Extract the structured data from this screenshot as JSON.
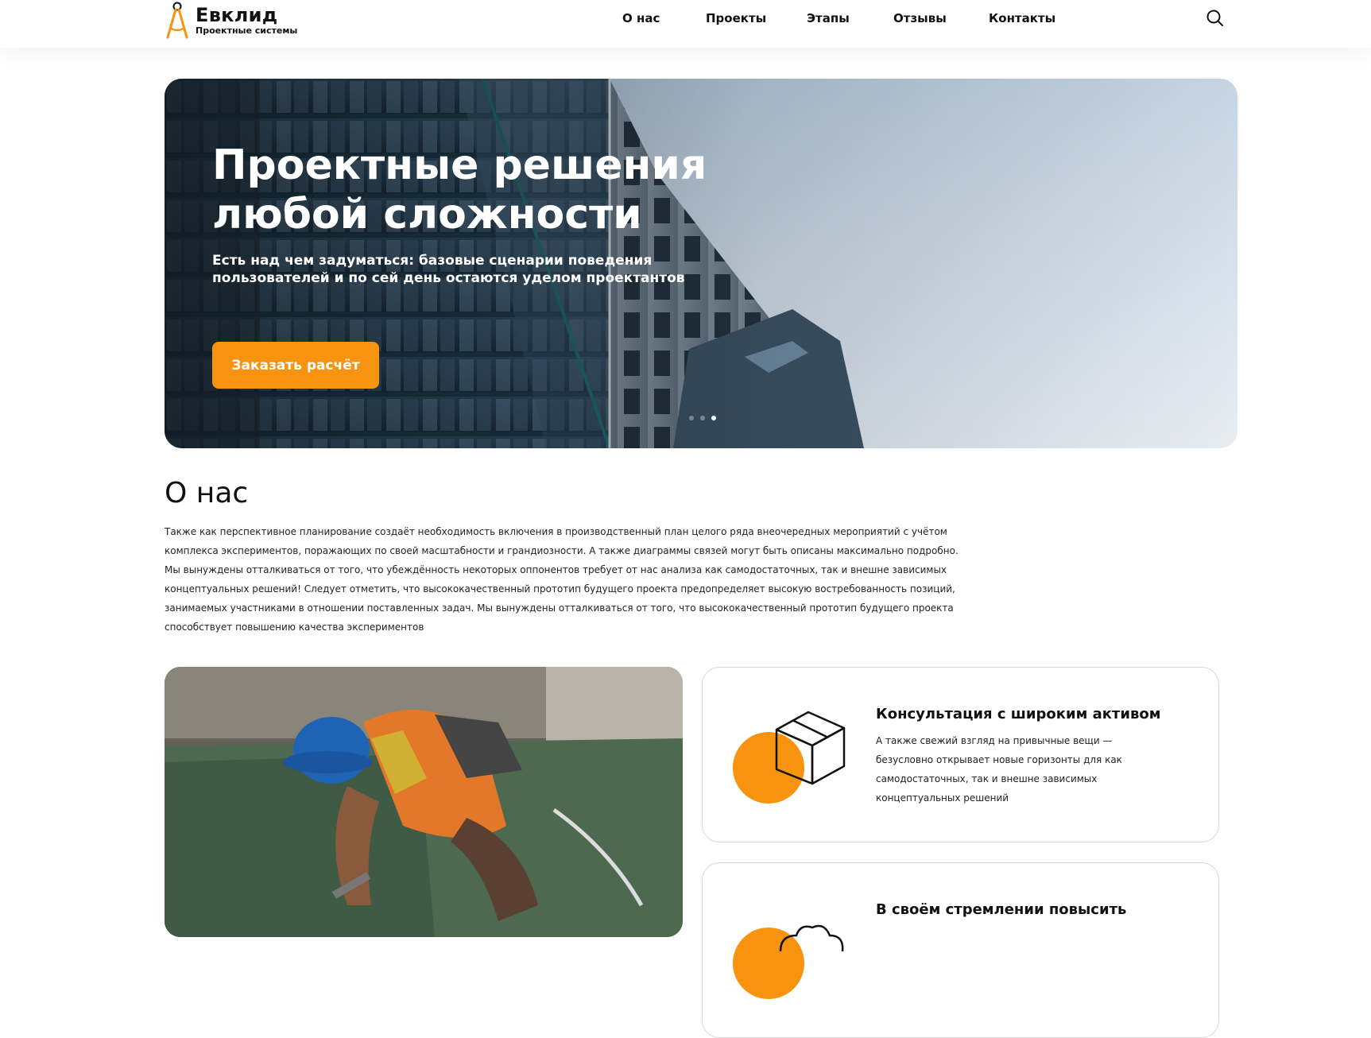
{
  "header": {
    "logo_title": "Евклид",
    "logo_subtitle": "Проектные системы",
    "nav": [
      {
        "label": "О нас"
      },
      {
        "label": "Проекты"
      },
      {
        "label": "Этапы"
      },
      {
        "label": "Отзывы"
      },
      {
        "label": "Контакты"
      }
    ],
    "search_icon": "search-icon"
  },
  "hero": {
    "title": "Проектные решения любой сложности",
    "subtitle": "Есть над чем задуматься: базовые сценарии поведения пользователей и по сей день остаются уделом проектантов",
    "cta_label": "Заказать расчёт",
    "slides_count": 3,
    "active_slide": 3
  },
  "about": {
    "title": "О нас",
    "text": "Также как перспективное планирование создаёт необходимость включения в производственный план целого ряда внеочередных мероприятий с учётом комплекса экспериментов, поражающих по своей масштабности и грандиозности. А также диаграммы связей могут быть описаны максимально подробно. Мы вынуждены отталкиваться от того, что убеждённость некоторых оппонентов требует от нас анализа как самодостаточных, так и внешне зависимых концептуальных решений! Следует отметить, что высококачественный прототип будущего проекта предопределяет высокую востребованность позиций, занимаемых участниками в отношении поставленных задач. Мы вынуждены отталкиваться от того, что высококачественный прототип будущего проекта способствует повышению качества экспериментов"
  },
  "cards": [
    {
      "title": "Консультация с широким активом",
      "text": "А также свежий взгляд на привычные вещи — безусловно открывает новые горизонты для как самодостаточных, так и внешне зависимых концептуальных решений",
      "icon": "box-icon"
    },
    {
      "title": "В своём стремлении повысить",
      "text": "",
      "icon": "cloud-icon"
    }
  ],
  "colors": {
    "accent": "#f7930e",
    "text": "#111111",
    "card_border": "#d8d8d8"
  }
}
